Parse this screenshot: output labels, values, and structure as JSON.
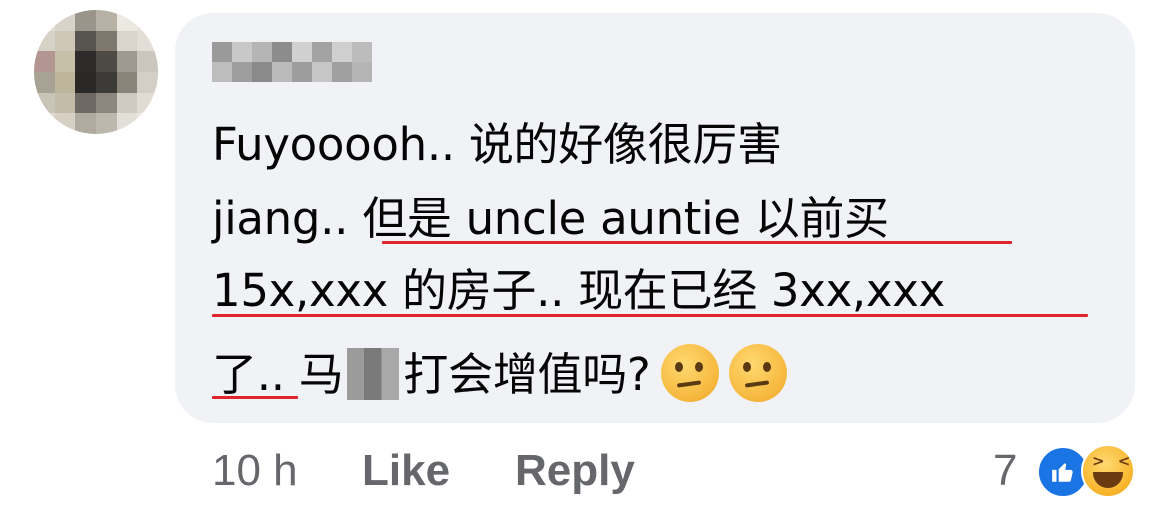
{
  "comment": {
    "lines": [
      "Fuyooooh.. 说的好像很厉害",
      "jiang.. ",
      "但是 uncle auntie 以前买",
      "15x,xxx 的房子.. 现在已经 3xx,xxx",
      "了",
      "..  马",
      "打会增值吗?"
    ]
  },
  "actions": {
    "time": "10 h",
    "like_label": "Like",
    "reply_label": "Reply"
  },
  "reactions": {
    "count": "7",
    "types": [
      "like-icon",
      "haha-icon"
    ]
  },
  "colors": {
    "bubble_bg": "#f0f2f5",
    "underline": "#e0242a",
    "like_blue": "#1b74e4",
    "meta_text": "#65676b"
  }
}
